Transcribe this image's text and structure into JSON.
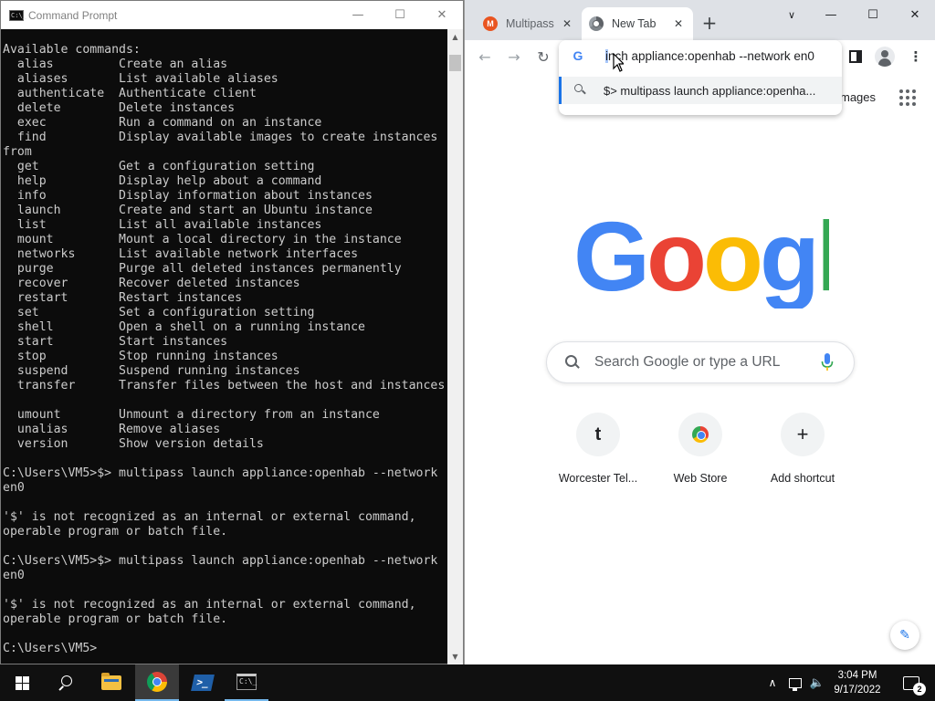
{
  "cmd": {
    "title": "Command Prompt",
    "console_text": "Available commands:\n  alias         Create an alias\n  aliases       List available aliases\n  authenticate  Authenticate client\n  delete        Delete instances\n  exec          Run a command on an instance\n  find          Display available images to create instances\nfrom\n  get           Get a configuration setting\n  help          Display help about a command\n  info          Display information about instances\n  launch        Create and start an Ubuntu instance\n  list          List all available instances\n  mount         Mount a local directory in the instance\n  networks      List available network interfaces\n  purge         Purge all deleted instances permanently\n  recover       Recover deleted instances\n  restart       Restart instances\n  set           Set a configuration setting\n  shell         Open a shell on a running instance\n  start         Start instances\n  stop          Stop running instances\n  suspend       Suspend running instances\n  transfer      Transfer files between the host and instances\n\n  umount        Unmount a directory from an instance\n  unalias       Remove aliases\n  version       Show version details\n\nC:\\Users\\VM5>$> multipass launch appliance:openhab --network\nen0\n\n'$' is not recognized as an internal or external command,\noperable program or batch file.\n\nC:\\Users\\VM5>$> multipass launch appliance:openhab --network\nen0\n\n'$' is not recognized as an internal or external command,\noperable program or batch file.\n\nC:\\Users\\VM5>",
    "icon_label": "C:\\_"
  },
  "chrome": {
    "tabs": [
      {
        "label": "Multipass",
        "favicon": "M",
        "active": false
      },
      {
        "label": "New Tab",
        "active": true
      }
    ],
    "omnibox": {
      "text_selected": "i",
      "text_rest": "nch appliance:openhab --network en0",
      "suggestion": "$> multipass launch appliance:openha..."
    },
    "ntp": {
      "images_link": "mages",
      "search_placeholder": "Search Google or type a URL",
      "shortcuts": [
        {
          "label": "Worcester Tel...",
          "icon_text": "t"
        },
        {
          "label": "Web Store",
          "icon": "web-store-icon"
        },
        {
          "label": "Add shortcut",
          "icon_text": "+"
        }
      ]
    }
  },
  "taskbar": {
    "clock_time": "3:04 PM",
    "clock_date": "9/17/2022",
    "notification_count": "2",
    "powershell_glyph": ">_"
  }
}
